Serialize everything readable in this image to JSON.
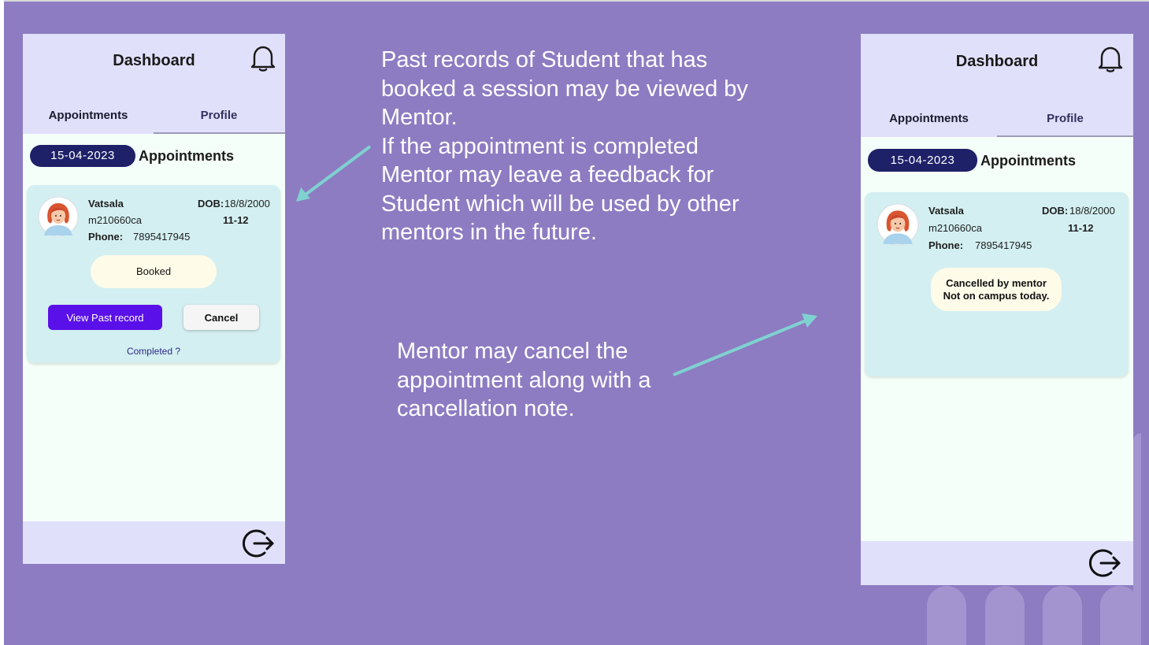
{
  "colors": {
    "background": "#8d7cc2",
    "header": "#e1e0fb",
    "screen": "#f5fff9",
    "card": "#d3eff1",
    "date_pill": "#1e2168",
    "primary_button": "#5a10e8",
    "arrow": "#7fd1d0"
  },
  "left_screen": {
    "title": "Dashboard",
    "bell_icon": "bell-icon",
    "tabs": [
      {
        "label": "Appointments",
        "active": true
      },
      {
        "label": "Profile",
        "active": false
      }
    ],
    "date": "15-04-2023",
    "appointments_heading": "Appointments",
    "card": {
      "name": "Vatsala",
      "id": "m210660ca",
      "phone_label": "Phone:",
      "phone": "7895417945",
      "dob_label": "DOB:",
      "dob": "18/8/2000",
      "slot": "11-12",
      "status": "Booked",
      "view_past_record_label": "View Past record",
      "cancel_label": "Cancel",
      "completed_link": "Completed ?"
    },
    "logout_icon": "logout-icon"
  },
  "right_screen": {
    "title": "Dashboard",
    "bell_icon": "bell-icon",
    "tabs": [
      {
        "label": "Appointments",
        "active": true
      },
      {
        "label": "Profile",
        "active": false
      }
    ],
    "date": "15-04-2023",
    "appointments_heading": "Appointments",
    "card": {
      "name": "Vatsala",
      "id": "m210660ca",
      "phone_label": "Phone:",
      "phone": "7895417945",
      "dob_label": "DOB:",
      "dob": "18/8/2000",
      "slot": "11-12",
      "status_line1": "Cancelled by mentor",
      "status_line2": "Not on campus today."
    },
    "logout_icon": "logout-icon"
  },
  "annotations": {
    "top": [
      "Past records of Student that has",
      "booked a session may be viewed by",
      "Mentor.",
      "If the appointment is completed",
      "Mentor may leave a feedback for",
      "Student  which will be used by other",
      "mentors in the future."
    ],
    "bottom": [
      "Mentor may cancel the",
      "appointment along with a",
      "cancellation note."
    ]
  }
}
